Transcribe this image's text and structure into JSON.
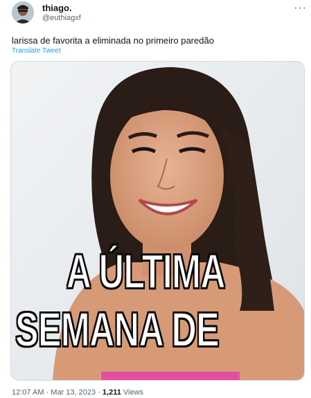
{
  "tweet": {
    "display_name": "thiago.",
    "handle": "@euthiagxf",
    "more_icon": "more-horizontal-icon",
    "text": "larissa de favorita a eliminada no primeiro paredão",
    "translate_label": "Translate Tweet",
    "media": {
      "caption_line1": "A ÚLTIMA",
      "caption_line2": "SEMANA DE"
    },
    "time": "12:07 AM",
    "separator": "·",
    "date": "Mar 13, 2023",
    "views_count": "1,211",
    "views_label": "Views"
  }
}
